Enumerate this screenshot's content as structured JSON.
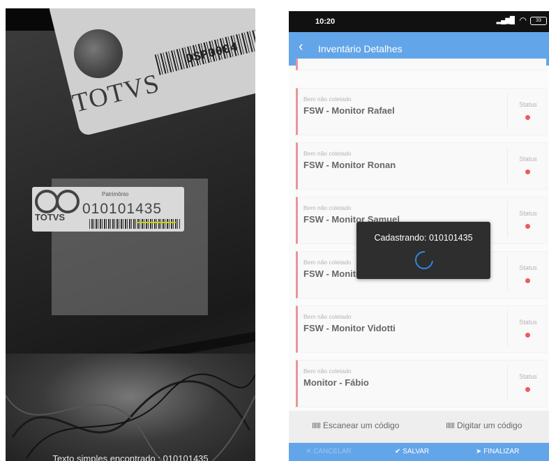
{
  "scanner": {
    "card_brand": "TOTVS",
    "card_code": "DSP0004",
    "label_heading": "Patrimônio",
    "label_number": "010101435",
    "label_brand": "TOTVS",
    "result_text": "Texto simples encontrado : 010101435"
  },
  "status_bar": {
    "time": "10:20",
    "battery": "33"
  },
  "app_bar": {
    "title": "Inventário Detalhes"
  },
  "items": [
    {
      "subtitle": "Bem não coletado",
      "name": "FSW - Monitor Rafael",
      "status_label": "Status"
    },
    {
      "subtitle": "Bem não coletado",
      "name": "FSW - Monitor Ronan",
      "status_label": "Status"
    },
    {
      "subtitle": "Bem não coletado",
      "name": "FSW - Monitor Samuel",
      "status_label": "Status"
    },
    {
      "subtitle": "Bem não coletado",
      "name": "FSW - Monitor Siqueira",
      "status_label": "Status"
    },
    {
      "subtitle": "Bem não coletado",
      "name": "FSW - Monitor Vidotti",
      "status_label": "Status"
    },
    {
      "subtitle": "Bem não coletado",
      "name": "Monitor - Fábio",
      "status_label": "Status"
    }
  ],
  "bottom": {
    "scan_label": "Escanear um código",
    "type_label": "Digitar um código"
  },
  "actions": {
    "cancel": "CANCELAR",
    "save": "SALVAR",
    "finish": "FINALIZAR"
  },
  "toast": {
    "text": "Cadastrando: 010101435"
  },
  "colors": {
    "primary": "#2f87e2",
    "status_dot": "#e3242b",
    "card_border": "#e0717c"
  }
}
